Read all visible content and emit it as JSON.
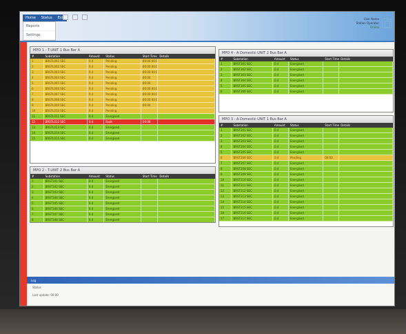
{
  "menu": [
    "Home",
    "Status",
    "Exit"
  ],
  "submenu": [
    "Reports",
    "Settings"
  ],
  "user": {
    "line1": "User Name",
    "line2": "Station Operator",
    "status": "Online"
  },
  "panel1": {
    "title": "MPO 1 - T-UNIT 1 Bus Bar A",
    "columns": [
      "#",
      "Substation",
      "Amount",
      "Status",
      "Start Time",
      "Details"
    ],
    "rows": [
      {
        "tone": "amber",
        "cells": [
          "1",
          "BRSTL001 SEC",
          "0.4",
          "Pending",
          "00:00 00:00",
          ""
        ]
      },
      {
        "tone": "amber",
        "cells": [
          "2",
          "BRSTL002 SEC",
          "0.4",
          "Pending",
          "00:00 00:00",
          ""
        ]
      },
      {
        "tone": "amber",
        "cells": [
          "3",
          "BRSTL003 SEC",
          "0.4",
          "Pending",
          "00:00 00:00",
          ""
        ]
      },
      {
        "tone": "amber",
        "cells": [
          "4",
          "BRSTL004 SEC",
          "0.4",
          "Pending",
          "00:00",
          ""
        ]
      },
      {
        "tone": "amber",
        "cells": [
          "5",
          "BRSTL005 SEC",
          "0.4",
          "Pending",
          "00:00",
          ""
        ]
      },
      {
        "tone": "amber",
        "cells": [
          "6",
          "BRSTL006 SEC",
          "0.4",
          "Pending",
          "00:00 00:00",
          ""
        ]
      },
      {
        "tone": "amber",
        "cells": [
          "7",
          "BRSTL007 SEC",
          "0.4",
          "Pending",
          "00:00 00:00",
          ""
        ]
      },
      {
        "tone": "amber",
        "cells": [
          "8",
          "BRSTL008 SEC",
          "0.4",
          "Pending",
          "00:00 00:00",
          ""
        ]
      },
      {
        "tone": "amber",
        "cells": [
          "9",
          "BRSTL009 SEC",
          "0.4",
          "Pending",
          "00:00",
          ""
        ]
      },
      {
        "tone": "amber",
        "cells": [
          "10",
          "BRSTL010 SEC",
          "0.4",
          "Pending",
          "",
          ""
        ]
      },
      {
        "tone": "green",
        "cells": [
          "11",
          "BRSTL011 SEC",
          "0.4",
          "Energised",
          "",
          ""
        ]
      },
      {
        "tone": "red",
        "cells": [
          "12",
          "BRSTL012 SEC",
          "0.4",
          "Fault",
          "00:00",
          ""
        ]
      },
      {
        "tone": "green",
        "cells": [
          "13",
          "BRSTL013 SEC",
          "0.4",
          "Energised",
          "",
          ""
        ]
      },
      {
        "tone": "green",
        "cells": [
          "14",
          "BRSTL014 SEC",
          "0.4",
          "Energised",
          "",
          ""
        ]
      },
      {
        "tone": "green",
        "cells": [
          "15",
          "BRSTL015 SEC",
          "0.4",
          "Energised",
          "",
          ""
        ]
      }
    ]
  },
  "panel2": {
    "title": "MPO 2 - T-UNIT 2 Bus Bar A",
    "columns": [
      "#",
      "Substation",
      "Amount",
      "Status",
      "Start Time",
      "Details"
    ],
    "rows": [
      {
        "tone": "green",
        "cells": [
          "1",
          "BRST101 SEC",
          "0.4",
          "Energised",
          "",
          ""
        ]
      },
      {
        "tone": "green",
        "cells": [
          "2",
          "BRST102 SEC",
          "0.4",
          "Energised",
          "",
          ""
        ]
      },
      {
        "tone": "green",
        "cells": [
          "3",
          "BRST103 SEC",
          "0.4",
          "Energised",
          "",
          ""
        ]
      },
      {
        "tone": "green",
        "cells": [
          "4",
          "BRST104 SEC",
          "0.4",
          "Energised",
          "",
          ""
        ]
      },
      {
        "tone": "green",
        "cells": [
          "5",
          "BRST105 SEC",
          "0.4",
          "Energised",
          "",
          ""
        ]
      },
      {
        "tone": "green",
        "cells": [
          "6",
          "BRST106 SEC",
          "0.4",
          "Energised",
          "",
          ""
        ]
      },
      {
        "tone": "green",
        "cells": [
          "7",
          "BRST107 SEC",
          "0.4",
          "Energised",
          "",
          ""
        ]
      },
      {
        "tone": "green",
        "cells": [
          "8",
          "BRST108 SEC",
          "0.4",
          "Energised",
          "",
          ""
        ]
      }
    ]
  },
  "panel3": {
    "title": "MPO 3 - A Domestic UNIT 1 Bus Bar A",
    "columns": [
      "#",
      "Substation",
      "Amount",
      "Status",
      "Start Time",
      "Details"
    ],
    "rows": [
      {
        "tone": "green",
        "cells": [
          "1",
          "BRST201 SEC",
          "0.4",
          "Energised",
          "",
          ""
        ]
      },
      {
        "tone": "green",
        "cells": [
          "2",
          "BRST202 SEC",
          "0.4",
          "Energised",
          "",
          ""
        ]
      },
      {
        "tone": "green",
        "cells": [
          "3",
          "BRST203 SEC",
          "0.4",
          "Energised",
          "",
          ""
        ]
      },
      {
        "tone": "green",
        "cells": [
          "4",
          "BRST204 SEC",
          "0.4",
          "Energised",
          "",
          ""
        ]
      },
      {
        "tone": "green",
        "cells": [
          "5",
          "BRST205 SEC",
          "0.4",
          "Energised",
          "",
          ""
        ]
      },
      {
        "tone": "amber",
        "cells": [
          "6",
          "BRST206 SEC",
          "0.4",
          "Pending",
          "00:00",
          ""
        ]
      },
      {
        "tone": "green",
        "cells": [
          "7",
          "BRST207 SEC",
          "0.4",
          "Energised",
          "",
          ""
        ]
      },
      {
        "tone": "green",
        "cells": [
          "8",
          "BRST208 SEC",
          "0.4",
          "Energised",
          "",
          ""
        ]
      },
      {
        "tone": "green",
        "cells": [
          "9",
          "BRST209 SEC",
          "0.4",
          "Energised",
          "",
          ""
        ]
      },
      {
        "tone": "green",
        "cells": [
          "10",
          "BRST210 SEC",
          "0.4",
          "Energised",
          "",
          ""
        ]
      },
      {
        "tone": "green",
        "cells": [
          "11",
          "BRST211 SEC",
          "0.4",
          "Energised",
          "",
          ""
        ]
      },
      {
        "tone": "green",
        "cells": [
          "12",
          "BRST212 SEC",
          "0.4",
          "Energised",
          "",
          ""
        ]
      },
      {
        "tone": "green",
        "cells": [
          "13",
          "BRST213 SEC",
          "0.4",
          "Energised",
          "",
          ""
        ]
      },
      {
        "tone": "green",
        "cells": [
          "14",
          "BRST214 SEC",
          "0.4",
          "Energised",
          "",
          ""
        ]
      },
      {
        "tone": "green",
        "cells": [
          "15",
          "BRST215 SEC",
          "0.4",
          "Energised",
          "",
          ""
        ]
      },
      {
        "tone": "green",
        "cells": [
          "16",
          "BRST216 SEC",
          "0.4",
          "Energised",
          "",
          ""
        ]
      },
      {
        "tone": "green",
        "cells": [
          "17",
          "BRST217 SEC",
          "0.4",
          "Energised",
          "",
          ""
        ]
      }
    ]
  },
  "panel4": {
    "title": "MPO 4 - A Domestic UNIT 2 Bus Bar A",
    "columns": [
      "#",
      "Substation",
      "Amount",
      "Status",
      "Start Time",
      "Details"
    ],
    "rows": [
      {
        "tone": "green",
        "cells": [
          "1",
          "BRST301 SEC",
          "0.4",
          "Energised",
          "",
          ""
        ]
      },
      {
        "tone": "green",
        "cells": [
          "2",
          "BRST302 SEC",
          "0.4",
          "Energised",
          "",
          ""
        ]
      },
      {
        "tone": "green",
        "cells": [
          "3",
          "BRST303 SEC",
          "0.4",
          "Energised",
          "",
          ""
        ]
      },
      {
        "tone": "green",
        "cells": [
          "4",
          "BRST304 SEC",
          "0.4",
          "Energised",
          "",
          ""
        ]
      },
      {
        "tone": "green",
        "cells": [
          "5",
          "BRST305 SEC",
          "0.4",
          "Energised",
          "",
          ""
        ]
      },
      {
        "tone": "green",
        "cells": [
          "6",
          "BRST306 SEC",
          "0.4",
          "Energised",
          "",
          ""
        ]
      }
    ]
  },
  "status": {
    "title": "Log",
    "line1": "Status",
    "line2": "Last update: 00:00"
  }
}
